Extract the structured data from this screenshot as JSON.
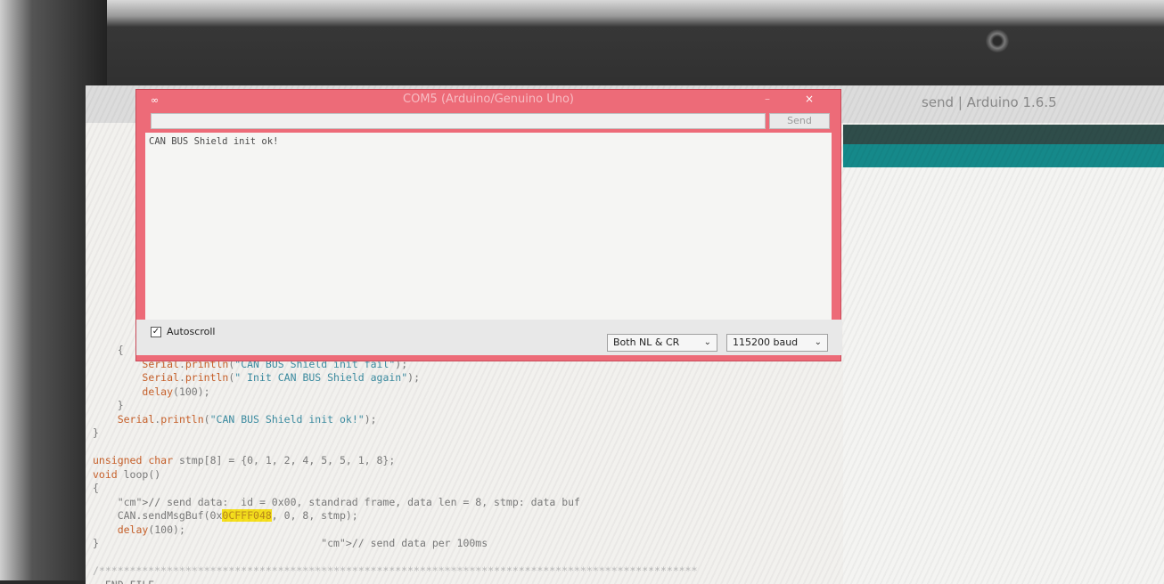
{
  "ide": {
    "title": "send | Arduino 1.6.5"
  },
  "serial_monitor": {
    "title": "COM5 (Arduino/Genuino Uno)",
    "logo": "∞",
    "minimize": "–",
    "close": "×",
    "input_value": "",
    "send_label": "Send",
    "output_lines": [
      "CAN BUS Shield init ok!"
    ],
    "autoscroll_label": "Autoscroll",
    "autoscroll_checked": true,
    "line_ending": "Both NL & CR",
    "baud_rate": "115200 baud"
  },
  "code": {
    "lines": [
      "    {",
      "        Serial.println(\"CAN BUS Shield init fail\");",
      "        Serial.println(\" Init CAN BUS Shield again\");",
      "        delay(100);",
      "    }",
      "    Serial.println(\"CAN BUS Shield init ok!\");",
      "}",
      "",
      "unsigned char stmp[8] = {0, 1, 2, 4, 5, 5, 1, 8};",
      "void loop()",
      "{",
      "    // send data:  id = 0x00, standrad frame, data len = 8, stmp: data buf",
      "    CAN.sendMsgBuf(0x0CFFF048, 0, 8, stmp);",
      "    delay(100);",
      "}                                    // send data per 100ms",
      "",
      "/*************************************************************************************************",
      "  END FILE",
      "*************************************************************************************************/"
    ],
    "highlight": "0CFFF048"
  },
  "colors": {
    "serial_frame": "#ed6b78",
    "ide_teal": "#15898a",
    "ide_toolbar": "#2f4d4a",
    "keyword_orange": "#c7602a",
    "string_blue": "#3c8ca1",
    "highlight_yellow": "#f6e01c"
  }
}
